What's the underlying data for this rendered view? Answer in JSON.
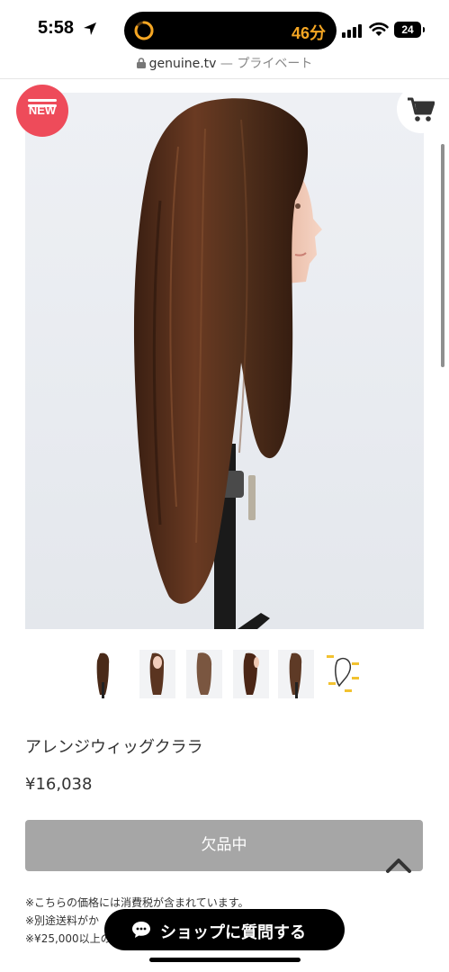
{
  "status_bar": {
    "time": "5:58",
    "timer": "46分",
    "battery": "24"
  },
  "url_bar": {
    "domain": "genuine.tv",
    "suffix": " — プライベート"
  },
  "product": {
    "badge": "NEW",
    "name": "アレンジウィッグクララ",
    "price": "¥16,038",
    "status_button": "欠品中",
    "image_count": 6
  },
  "notes": [
    "※こちらの価格には消費税が含まれています。",
    "※別途送料がか",
    "※¥25,000以上の"
  ],
  "chat_button": {
    "label": "ショップに質問する"
  },
  "colors": {
    "badge": "#ee4b5a",
    "timer": "#f5a623",
    "disabled_button": "#a6a6a6",
    "chat_button": "#000000"
  }
}
